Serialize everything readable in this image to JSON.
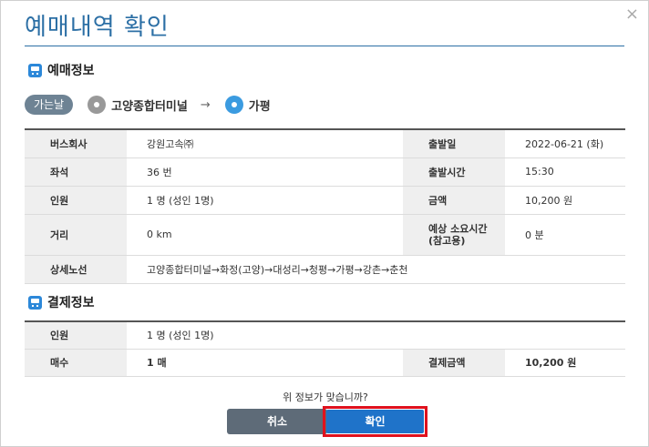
{
  "dialog": {
    "title": "예매내역 확인",
    "close_label": "×"
  },
  "reservation_section": {
    "heading": "예매정보",
    "icon": "bus-icon"
  },
  "route": {
    "badge": "가는날",
    "origin": "고양종합터미널",
    "arrow": "→",
    "destination": "가평"
  },
  "reservation_table": {
    "rows": [
      {
        "l1": "버스회사",
        "v1": "강원고속㈜",
        "l2": "출발일",
        "v2": "2022-06-21 (화)"
      },
      {
        "l1": "좌석",
        "v1": "36 번",
        "l2": "출발시간",
        "v2": "15:30"
      },
      {
        "l1": "인원",
        "v1": "1 명 (성인 1명)",
        "l2": "금액",
        "v2": "10,200 원"
      },
      {
        "l1": "거리",
        "v1": "0 km",
        "l2": "예상 소요시간\n(참고용)",
        "v2": "0 분"
      }
    ],
    "route_detail_label": "상세노선",
    "route_detail_value": "고양종합터미널→화정(고양)→대성리→청평→가평→강촌→춘천"
  },
  "payment_section": {
    "heading": "결제정보",
    "icon": "bus-icon"
  },
  "payment_table": {
    "people_label": "인원",
    "people_value": "1 명 (성인 1명)",
    "count_label": "매수",
    "count_value": "1 매",
    "amount_label": "결제금액",
    "amount_value": "10,200 원"
  },
  "footer": {
    "question": "위 정보가 맞습니까?",
    "cancel_label": "취소",
    "confirm_label": "확인"
  },
  "colors": {
    "title": "#2c6fa5",
    "confirm_button": "#1f73c9",
    "cancel_button": "#5e6b78",
    "highlight_border": "#e0121e"
  }
}
